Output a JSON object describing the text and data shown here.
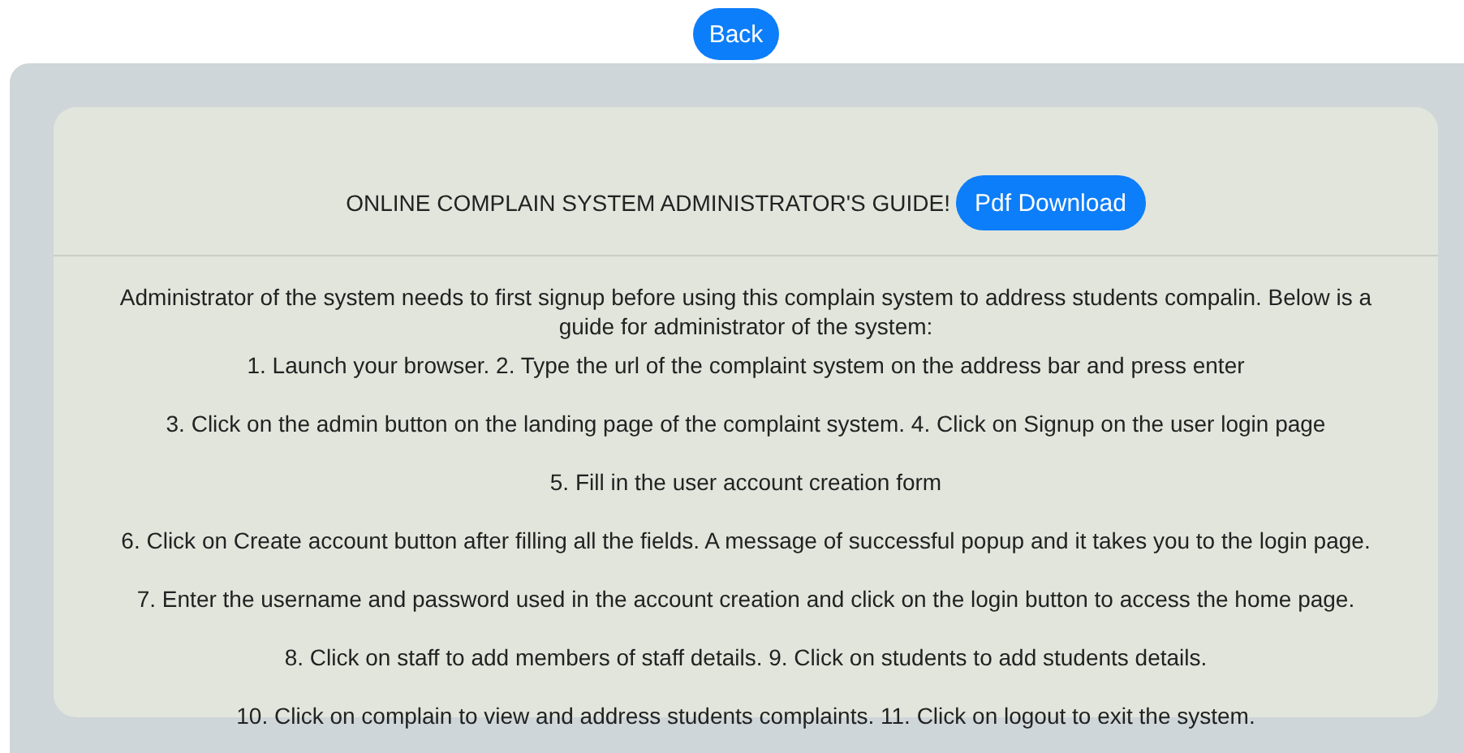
{
  "back_button": {
    "label": "Back"
  },
  "guide": {
    "title": "ONLINE COMPLAIN SYSTEM ADMINISTRATOR'S GUIDE!",
    "download_button": {
      "label": "Pdf Download"
    },
    "intro": "Administrator of the system needs to first signup before using this complain system to address students compalin. Below is a guide for administrator of the system:",
    "steps": [
      "1. Launch your browser. 2. Type the url of the complaint system on the address bar and press enter",
      "3. Click on the admin button on the landing page of the complaint system. 4. Click on Signup on the user login page",
      "5. Fill in the user account creation form",
      "6. Click on Create account button after filling all the fields. A message of successful popup and it takes you to the login page.",
      "7. Enter the username and password used in the account creation and click on the login button to access the home page.",
      "8. Click on staff to add members of staff details. 9. Click on students to add students details.",
      "10. Click on complain to view and address students complaints. 11. Click on logout to exit the system."
    ]
  }
}
